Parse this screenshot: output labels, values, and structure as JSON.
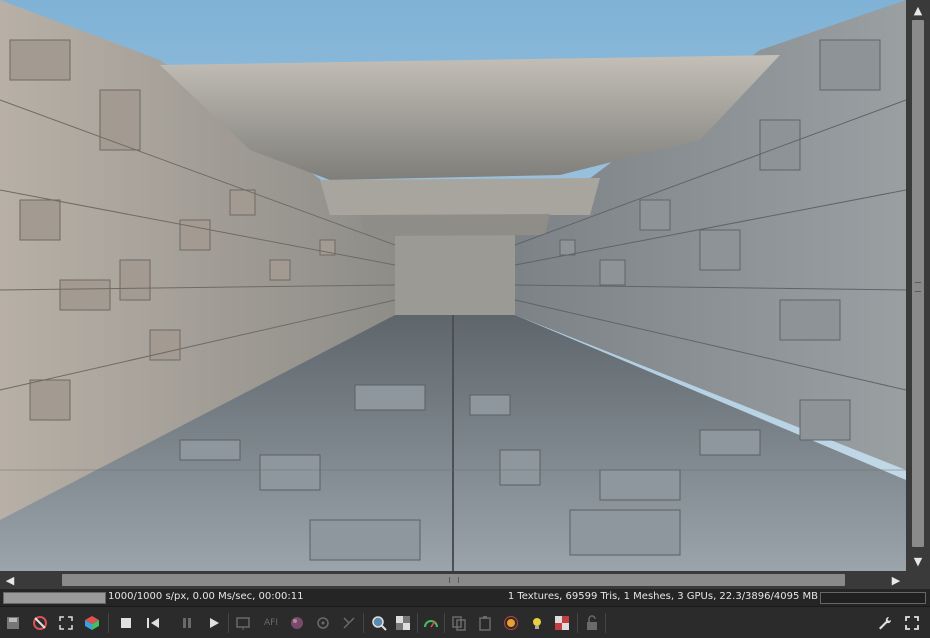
{
  "viewport": {
    "description_icon": "rendered-scene"
  },
  "scrollbars": {
    "up_glyph": "▲",
    "down_glyph": "▼",
    "left_glyph": "◀",
    "right_glyph": "▶"
  },
  "status": {
    "samples_text": "1000/1000 s/px, 0.00 Ms/sec, 00:00:11",
    "stats_text": "1 Textures, 69599 Tris, 1 Meshes, 3 GPUs, 22.3/3896/4095 MB",
    "progress_fraction": 1.0,
    "gpu_memory_fraction": 0.0
  },
  "toolbar": {
    "icons": [
      "save-render-icon",
      "clear-icon",
      "fit-view-icon",
      "color-cube-icon",
      "stop-icon",
      "restart-icon",
      "start-icon",
      "pause-icon",
      "camera-view-icon",
      "autofocus-icon",
      "material-picker-icon",
      "camera-target-icon",
      "white-balance-icon",
      "zoom-icon",
      "alpha-channel-icon",
      "priority-icon",
      "copy-icon",
      "paste-icon",
      "sun-direction-icon",
      "lights-icon",
      "checker-icon",
      "lock-icon",
      "settings-wrench-icon",
      "fullscreen-icon"
    ],
    "afi_label": "AFI"
  },
  "colors": {
    "background": "#1e1e1e",
    "toolbar": "#2b2b2b",
    "scrollbar_thumb": "#8a8a8a",
    "stop_accent": "#e05050",
    "color_cube_accent": "#3aa0e0"
  }
}
